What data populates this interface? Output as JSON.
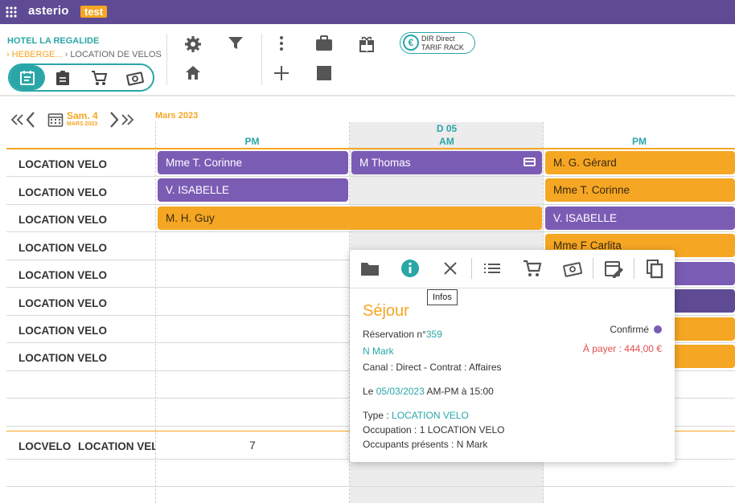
{
  "app": {
    "brand": "asterio",
    "env_badge": "test"
  },
  "header": {
    "hotel": "HOTEL LA REGALIDE",
    "breadcrumb": [
      "HEBERGE...",
      "LOCATION DE VELOS"
    ],
    "tarif": {
      "line1": "DIR Direct",
      "line2": "TARIF RACK"
    }
  },
  "calendar": {
    "date_day": "Sam. 4",
    "date_month": "MARS 2023",
    "month_label": "Mars 2023",
    "columns": [
      {
        "day": "",
        "period": "PM"
      },
      {
        "day": "D 05",
        "period": "AM"
      },
      {
        "day": "",
        "period": "PM"
      }
    ],
    "rows": [
      "LOCATION VELO",
      "LOCATION VELO",
      "LOCATION VELO",
      "LOCATION VELO",
      "LOCATION VELO",
      "LOCATION VELO",
      "LOCATION VELO",
      "LOCATION VELO"
    ],
    "bottom_row": {
      "code": "LOCVELO",
      "label": "LOCATION VELO",
      "count": "7"
    },
    "bookings": [
      {
        "name": "Mme T. Corinne",
        "color": "#7b5cb5"
      },
      {
        "name": "M Thomas",
        "color": "#7b5cb5",
        "icon": "credit-card-icon"
      },
      {
        "name": "M. G. Gérard",
        "color": "#f5a623"
      },
      {
        "name": "V. ISABELLE",
        "color": "#7b5cb5"
      },
      {
        "name": "Mme T. Corinne",
        "color": "#f5a623"
      },
      {
        "name": "M. H. Guy",
        "color": "#f5a623"
      },
      {
        "name": "V. ISABELLE",
        "color": "#7b5cb5"
      },
      {
        "name": "Mme F Carlita",
        "color": "#f5a623"
      }
    ]
  },
  "popup": {
    "tooltip": "Infos",
    "title": "Séjour",
    "reservation_label": "Réservation n°",
    "reservation_number": "359",
    "status": "Confirmé",
    "guest": "N Mark",
    "to_pay": "À payer : 444,00 €",
    "canal": "Canal : Direct - Contrat : Affaires",
    "date_prefix": "Le",
    "date": "05/03/2023",
    "date_suffix": "AM-PM à 15:00",
    "type_label": "Type :",
    "type_value": "LOCATION VELO",
    "occupation": "Occupation : 1 LOCATION VELO",
    "occupants": "Occupants présents : N Mark"
  }
}
